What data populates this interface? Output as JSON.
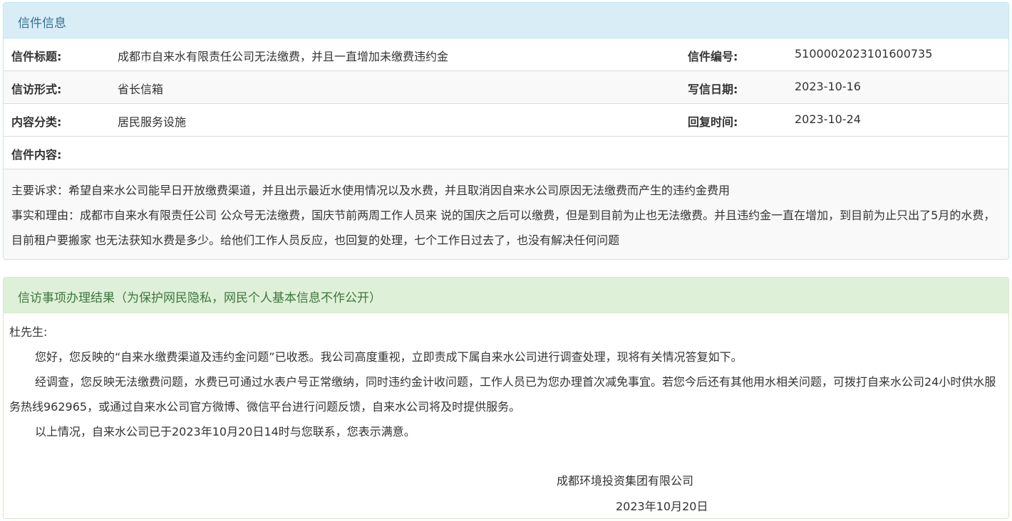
{
  "letter": {
    "header": "信件信息",
    "rows": [
      {
        "label": "信件标题:",
        "value": "成都市自来水有限责任公司无法缴费，并且一直增加未缴费违约金",
        "label2": "信件编号:",
        "value2": "5100002023101600735"
      },
      {
        "label": "信访形式:",
        "value": "省长信箱",
        "label2": "写信日期:",
        "value2": "2023-10-16"
      },
      {
        "label": "内容分类:",
        "value": "居民服务设施",
        "label2": "回复时间:",
        "value2": "2023-10-24"
      }
    ],
    "content_label": "信件内容:",
    "content_lines": [
      "主要诉求：希望自来水公司能早日开放缴费渠道，并且出示最近水使用情况以及水费，并且取消因自来水公司原因无法缴费而产生的违约金费用",
      "事实和理由：成都市自来水有限责任公司 公众号无法缴费，国庆节前两周工作人员来 说的国庆之后可以缴费，但是到目前为止也无法缴费。并且违约金一直在增加，到目前为止只出了5月的水费，目前租户要搬家 也无法获知水费是多少。给他们工作人员反应，也回复的处理，七个工作日过去了，也没有解决任何问题"
    ]
  },
  "result": {
    "header": "信访事项办理结果（为保护网民隐私，网民个人基本信息不作公开）",
    "salutation": "杜先生:",
    "paragraphs": [
      "您好，您反映的“自来水缴费渠道及违约金问题”已收悉。我公司高度重视，立即责成下属自来水公司进行调查处理，现将有关情况答复如下。",
      "经调查，您反映无法缴费问题，水费已可通过水表户号正常缴纳，同时违约金计收问题，工作人员已为您办理首次减免事宜。若您今后还有其他用水相关问题，可拨打自来水公司24小时供水服务热线962965，或通过自来水公司官方微博、微信平台进行问题反馈，自来水公司将及时提供服务。",
      "以上情况，自来水公司已于2023年10月20日14时与您联系，您表示满意。"
    ],
    "signature_org": "成都环境投资集团有限公司",
    "signature_date": "2023年10月20日"
  }
}
